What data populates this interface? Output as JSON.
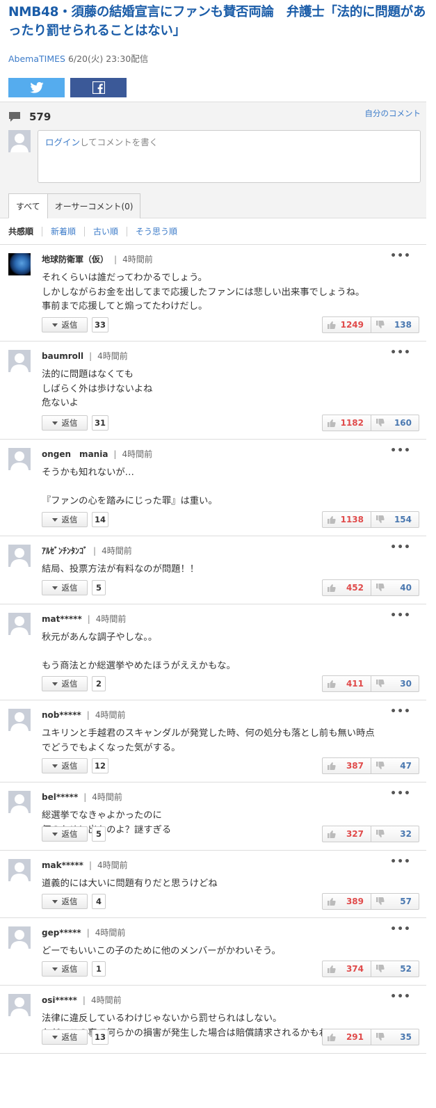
{
  "article": {
    "title": "NMB48・須藤の結婚宣言にファンも賛否両論　弁護士「法的に問題があったり罰せられることはない」",
    "source": "AbemaTIMES",
    "date": "6/20(火) 23:30配信"
  },
  "share": {
    "twitter_icon": "twitter-icon",
    "facebook_icon": "facebook-icon"
  },
  "comment_box": {
    "count": "579",
    "my_comments": "自分のコメント",
    "login_link": "ログイン",
    "placeholder_rest": "してコメントを書く"
  },
  "tabs": [
    "すべて",
    "オーサーコメント(0)"
  ],
  "sort": [
    "共感順",
    "新着順",
    "古い順",
    "そう思う順"
  ],
  "reply_label": "返信",
  "comments": [
    {
      "name": "地球防衛軍（仮）",
      "time": "4時間前",
      "body": "それくらいは誰だってわかるでしょう。\nしかしながらお金を出してまで応援したファンには悲しい出来事でしょうね。\n事前まで応援してと煽ってたわけだし。",
      "replies": "33",
      "up": "1249",
      "down": "138"
    },
    {
      "name": "baumroll",
      "time": "4時間前",
      "body": "法的に問題はなくても\nしばらく外は歩けないよね\n危ないよ",
      "replies": "31",
      "up": "1182",
      "down": "160"
    },
    {
      "name": "ongen　mania",
      "time": "4時間前",
      "body": "そうかも知れないが…\n\n『ファンの心を踏みにじった罪』は重い。",
      "replies": "14",
      "up": "1138",
      "down": "154"
    },
    {
      "name": "ｱﾙｾﾞﾝﾁﾝﾀﾝｺﾞ",
      "time": "4時間前",
      "body": "結局、投票方法が有料なのが問題！！",
      "replies": "5",
      "up": "452",
      "down": "40"
    },
    {
      "name": "mat*****",
      "time": "4時間前",
      "body": "秋元があんな調子やしな。。\n\nもう商法とか総選挙やめたほうがええかもな。",
      "replies": "2",
      "up": "411",
      "down": "30"
    },
    {
      "name": "nob*****",
      "time": "4時間前",
      "body": "ユキリンと手越君のスキャンダルが発覚した時、何の処分も落とし前も無い時点\nでどうでもよくなった気がする。",
      "replies": "12",
      "up": "387",
      "down": "47"
    },
    {
      "name": "bel*****",
      "time": "4時間前",
      "body": "総選挙でなきゃよかったのに\n何のために出たのよ？謎すぎる",
      "replies": "5",
      "up": "327",
      "down": "32"
    },
    {
      "name": "mak*****",
      "time": "4時間前",
      "body": "道義的には大いに問題有りだと思うけどね",
      "replies": "4",
      "up": "389",
      "down": "57"
    },
    {
      "name": "gep*****",
      "time": "4時間前",
      "body": "どーでもいいこの子のために他のメンバーがかわいそう。",
      "replies": "1",
      "up": "374",
      "down": "52"
    },
    {
      "name": "osi*****",
      "time": "4時間前",
      "body": "法律に違反しているわけじゃないから罰せられはしない。\nただ、この事で何らかの損害が発生した場合は賠償請求されるかもね。",
      "replies": "13",
      "up": "291",
      "down": "35"
    }
  ]
}
